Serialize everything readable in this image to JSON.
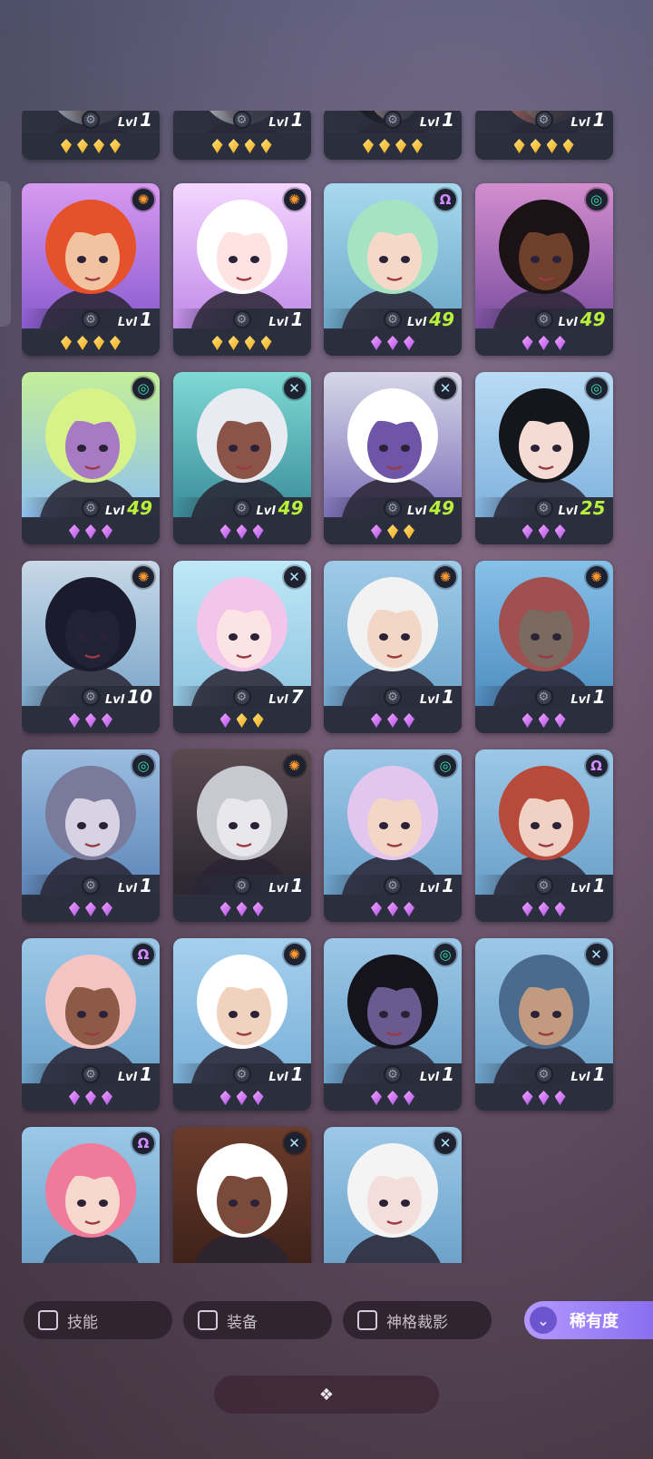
{
  "level_prefix": "Lvl",
  "heroes": [
    {
      "level": "1",
      "class": "support",
      "stars": [
        "gold",
        "gold",
        "gold",
        "gold"
      ],
      "sky": [
        "#caa6ff",
        "#7b5ca8"
      ],
      "hair": "#e7e7ee",
      "skin": "#f0d3c2"
    },
    {
      "level": "1",
      "class": "support",
      "stars": [
        "gold",
        "gold",
        "gold",
        "gold"
      ],
      "sky": [
        "#e6e6f0",
        "#b0a8c8"
      ],
      "hair": "#ffffff",
      "skin": "#f7d4dc"
    },
    {
      "level": "1",
      "class": "support",
      "stars": [
        "gold",
        "gold",
        "gold",
        "gold"
      ],
      "sky": [
        "#cfcfd8",
        "#2a2a33"
      ],
      "hair": "#111",
      "skin": "#e8cfc8"
    },
    {
      "level": "1",
      "class": "support",
      "stars": [
        "gold",
        "gold",
        "gold",
        "gold"
      ],
      "sky": [
        "#b58bd4",
        "#8a5cb0"
      ],
      "hair": "#d07a6a",
      "skin": "#e8b89a"
    },
    {
      "level": "1",
      "class": "fighter",
      "stars": [
        "gold",
        "gold",
        "gold",
        "gold"
      ],
      "sky": [
        "#d79af0",
        "#8a5ad0"
      ],
      "hair": "#e5512a",
      "skin": "#f2c3a0"
    },
    {
      "level": "1",
      "class": "fighter",
      "stars": [
        "gold",
        "gold",
        "gold",
        "gold"
      ],
      "sky": [
        "#f4d6ff",
        "#c08ae8"
      ],
      "hair": "#ffffff",
      "skin": "#ffe2e2"
    },
    {
      "level": "49",
      "class": "mage",
      "stars": [
        "purple",
        "purple",
        "purple"
      ],
      "sky": [
        "#a9d9ef",
        "#6aa6c6"
      ],
      "hair": "#a6e3c3",
      "skin": "#f5d8c8"
    },
    {
      "level": "49",
      "class": "tank",
      "stars": [
        "purple",
        "purple",
        "purple"
      ],
      "sky": [
        "#d48ecf",
        "#7b4ea0"
      ],
      "hair": "#1a1215",
      "skin": "#6e3f2b"
    },
    {
      "level": "49",
      "class": "tank",
      "stars": [
        "purple",
        "purple",
        "purple"
      ],
      "sky": [
        "#c4ef9a",
        "#8fc1ef"
      ],
      "hair": "#d8f28a",
      "skin": "#a87ac4"
    },
    {
      "level": "49",
      "class": "marksman",
      "stars": [
        "purple",
        "purple",
        "purple"
      ],
      "sky": [
        "#7fd9d4",
        "#3a8d9a"
      ],
      "hair": "#e8ecf2",
      "skin": "#8a5448"
    },
    {
      "level": "49",
      "class": "marksman",
      "stars": [
        "purple",
        "gold",
        "gold"
      ],
      "sky": [
        "#d7d7e8",
        "#7c70b8"
      ],
      "hair": "#ffffff",
      "skin": "#6e55a8"
    },
    {
      "level": "25",
      "class": "tank",
      "stars": [
        "purple",
        "purple",
        "purple"
      ],
      "sky": [
        "#b9dcf5",
        "#7fb1dc"
      ],
      "hair": "#15151c",
      "skin": "#f4dcd4"
    },
    {
      "level": "10",
      "class": "fighter",
      "stars": [
        "purple",
        "purple",
        "purple"
      ],
      "sky": [
        "#c8d8e8",
        "#7aa6c8"
      ],
      "hair": "#1b1b2e",
      "skin": "#222235"
    },
    {
      "level": "7",
      "class": "marksman",
      "stars": [
        "purple",
        "gold",
        "gold"
      ],
      "sky": [
        "#bfe8f8",
        "#8fc4e0"
      ],
      "hair": "#f2c6ea",
      "skin": "#fde4e4"
    },
    {
      "level": "1",
      "class": "fighter",
      "stars": [
        "purple",
        "purple",
        "purple"
      ],
      "sky": [
        "#9fcbe8",
        "#6fa4cc"
      ],
      "hair": "#f2f2f2",
      "skin": "#f2d6c6"
    },
    {
      "level": "1",
      "class": "fighter",
      "stars": [
        "purple",
        "purple",
        "purple"
      ],
      "sky": [
        "#86c1e8",
        "#4e8dc0"
      ],
      "hair": "#a05050",
      "skin": "#7a6a60"
    },
    {
      "level": "1",
      "class": "tank",
      "stars": [
        "purple",
        "purple",
        "purple"
      ],
      "sky": [
        "#9bbde0",
        "#5d86b8"
      ],
      "hair": "#7a7a9c",
      "skin": "#d7d2e4"
    },
    {
      "level": "1",
      "class": "fighter",
      "stars": [
        "purple",
        "purple",
        "purple"
      ],
      "sky": [
        "#5a4a50",
        "#2c2630"
      ],
      "hair": "#c8c8d0",
      "skin": "#e8e8ec"
    },
    {
      "level": "1",
      "class": "tank",
      "stars": [
        "purple",
        "purple",
        "purple"
      ],
      "sky": [
        "#9cc8e8",
        "#6aa0c8"
      ],
      "hair": "#e2c6ee",
      "skin": "#f4d6c6"
    },
    {
      "level": "1",
      "class": "mage",
      "stars": [
        "purple",
        "purple",
        "purple"
      ],
      "sky": [
        "#9cc8e8",
        "#6aa0c8"
      ],
      "hair": "#b84a3c",
      "skin": "#f1d1c4"
    },
    {
      "level": "1",
      "class": "mage",
      "stars": [
        "purple",
        "purple",
        "purple"
      ],
      "sky": [
        "#9cc8e8",
        "#6aa0c8"
      ],
      "hair": "#f3c4c2",
      "skin": "#8d5a48"
    },
    {
      "level": "1",
      "class": "fighter",
      "stars": [
        "purple",
        "purple",
        "purple"
      ],
      "sky": [
        "#a6d0ee",
        "#7ab0d8"
      ],
      "hair": "#ffffff",
      "skin": "#f1d2bf"
    },
    {
      "level": "1",
      "class": "tank",
      "stars": [
        "purple",
        "purple",
        "purple"
      ],
      "sky": [
        "#9cc8e8",
        "#6aa0c8"
      ],
      "hair": "#15131c",
      "skin": "#6a5a90"
    },
    {
      "level": "1",
      "class": "marksman",
      "stars": [
        "purple",
        "purple",
        "purple"
      ],
      "sky": [
        "#9cc8e8",
        "#6aa0c8"
      ],
      "hair": "#4a6a8e",
      "skin": "#c19a80"
    },
    {
      "level": "",
      "class": "mage",
      "stars": [],
      "sky": [
        "#9cc8e8",
        "#6aa0c8"
      ],
      "hair": "#f07a9a",
      "skin": "#f6d8cc"
    },
    {
      "level": "",
      "class": "marksman",
      "stars": [],
      "sky": [
        "#6b3c2c",
        "#3b2018"
      ],
      "hair": "#ffffff",
      "skin": "#7a4a3a"
    },
    {
      "level": "",
      "class": "marksman",
      "stars": [],
      "sky": [
        "#9cc8e8",
        "#6aa0c8"
      ],
      "hair": "#f4f4f4",
      "skin": "#f4dedb"
    }
  ],
  "class_badges": {
    "fighter": {
      "glyph": "✺",
      "color": "#ff9a2e"
    },
    "mage": {
      "glyph": "Ω",
      "color": "#d48cff"
    },
    "tank": {
      "glyph": "◎",
      "color": "#3de0b0"
    },
    "marksman": {
      "glyph": "✕",
      "color": "#b4e8ff"
    },
    "support": {
      "glyph": "",
      "color": "#ffffff"
    }
  },
  "filters": {
    "skill_label": "技能",
    "equipment_label": "装备",
    "divine_label": "神格裁影",
    "rarity_label": "稀有度"
  },
  "icons": {
    "gear": "gear-icon",
    "rarity": "double-chevron-down-icon",
    "handle": "diamond-cluster-icon"
  }
}
